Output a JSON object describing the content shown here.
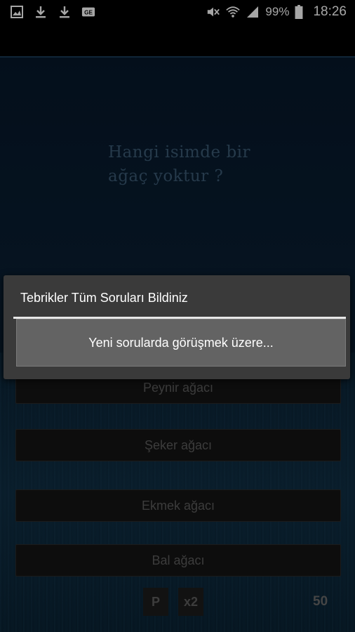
{
  "status_bar": {
    "left_icons": [
      "gallery-icon",
      "download-icon",
      "download-icon",
      "ge-icon"
    ],
    "right_icons": [
      "mute-icon",
      "wifi-icon",
      "signal-icon",
      "battery-icon"
    ],
    "battery_percent": "99%",
    "time": "18:26"
  },
  "question": {
    "line1": "Hangi isimde bir",
    "line2": "ağaç yoktur ?"
  },
  "answers": [
    "Peynir ağacı",
    "Şeker ağacı",
    "Ekmek ağacı",
    "Bal ağacı"
  ],
  "jokers": {
    "pass_label": "P",
    "double_label": "x2"
  },
  "score": "50",
  "dialog": {
    "title": "Tebrikler Tüm Soruları Bildiniz",
    "message": "Yeni sorularda görüşmek üzere..."
  },
  "colors": {
    "background": "#0a1f33",
    "dialog_bg": "#3a3a3a",
    "dialog_message_bg": "#636363",
    "question_text": "#3b5a74"
  }
}
